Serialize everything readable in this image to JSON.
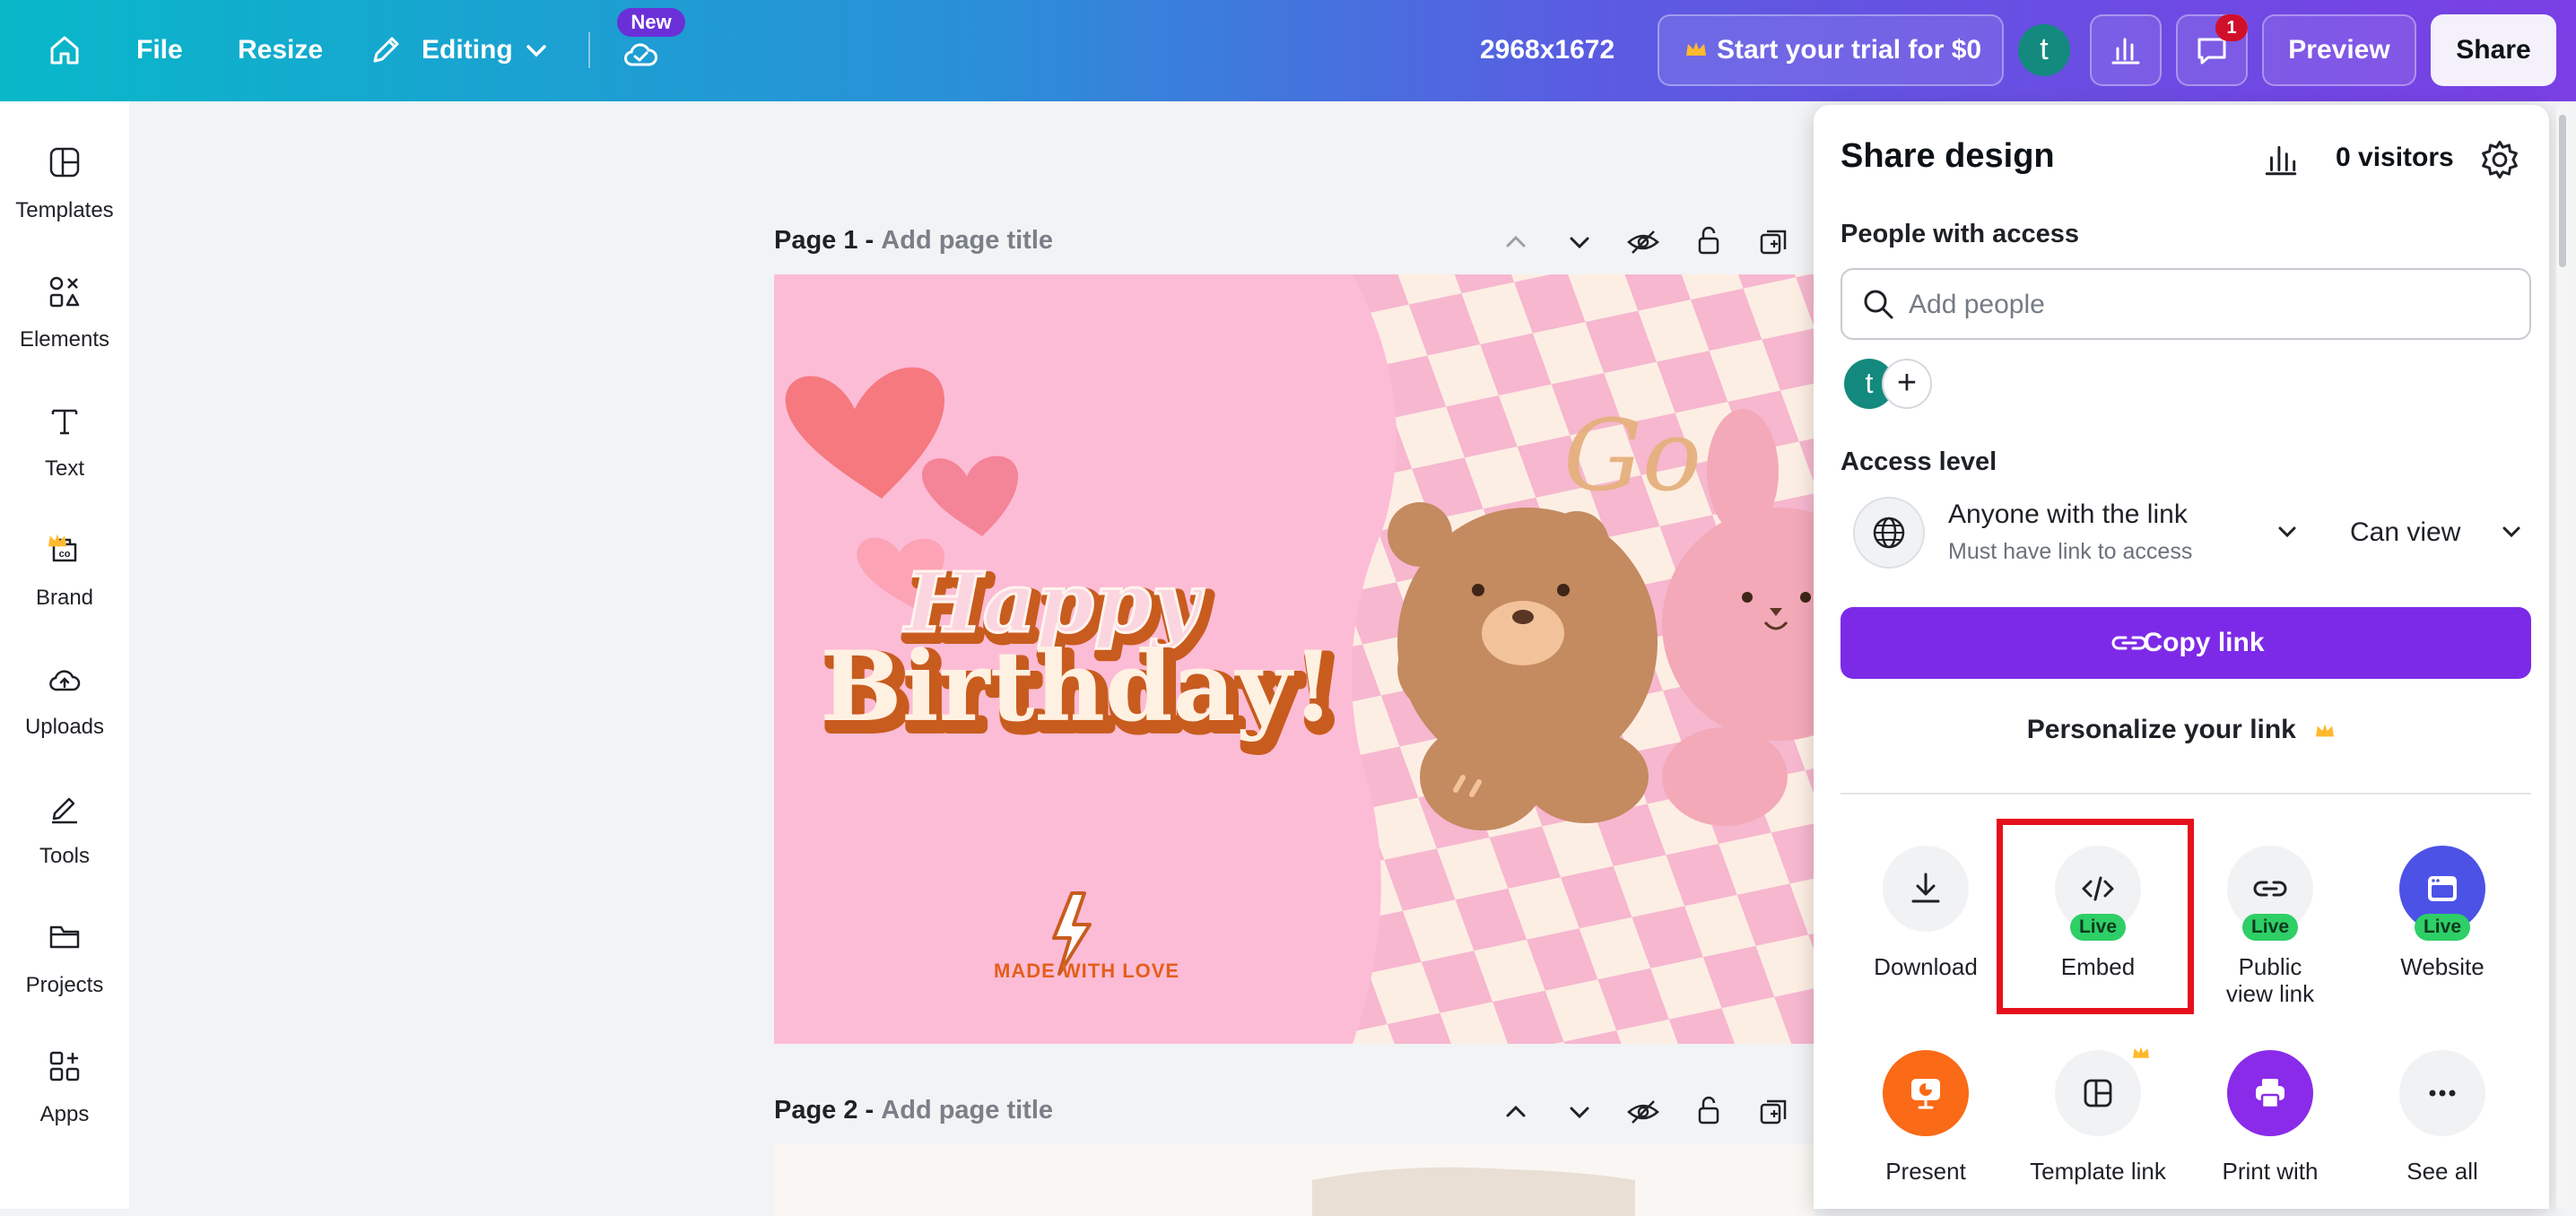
{
  "topbar": {
    "file_label": "File",
    "resize_label": "Resize",
    "editing_label": "Editing",
    "new_badge": "New",
    "dimensions": "2968x1672",
    "trial_label": "Start your trial for $0",
    "avatar_initial": "t",
    "notification_count": "1",
    "preview_label": "Preview",
    "share_label": "Share"
  },
  "sidebar": {
    "items": [
      {
        "label": "Templates",
        "icon": "templates-icon"
      },
      {
        "label": "Elements",
        "icon": "elements-icon"
      },
      {
        "label": "Text",
        "icon": "text-icon"
      },
      {
        "label": "Brand",
        "icon": "brand-icon"
      },
      {
        "label": "Uploads",
        "icon": "uploads-icon"
      },
      {
        "label": "Tools",
        "icon": "tools-icon"
      },
      {
        "label": "Projects",
        "icon": "projects-icon"
      },
      {
        "label": "Apps",
        "icon": "apps-icon"
      }
    ]
  },
  "canvas": {
    "page1": {
      "number": "Page 1 -",
      "placeholder": "Add page title"
    },
    "page2": {
      "number": "Page 2 -",
      "placeholder": "Add page title"
    },
    "design": {
      "happy": "Happy",
      "birthday": "Birthday!",
      "go_text": "Go~",
      "made_with_love": "MADE WITH LOVE"
    }
  },
  "share_panel": {
    "title": "Share design",
    "visitors": "0 visitors",
    "people_label": "People with access",
    "search_placeholder": "Add people",
    "avatar_initial": "t",
    "access_level_label": "Access level",
    "access_option": "Anyone with the link",
    "access_sub": "Must have link to access",
    "permission": "Can view",
    "copy_link_label": "Copy link",
    "personalize_label": "Personalize your link",
    "live_badge": "Live",
    "options_row1": [
      {
        "label": "Download",
        "live": false
      },
      {
        "label": "Embed",
        "live": true
      },
      {
        "label": "Public view link",
        "live": true
      },
      {
        "label": "Website",
        "live": true
      }
    ],
    "options_row2": [
      {
        "label": "Present"
      },
      {
        "label": "Template link"
      },
      {
        "label": "Print with"
      },
      {
        "label": "See all"
      }
    ]
  },
  "colors": {
    "accent_purple": "#7d2ae8",
    "live_green": "#2ecf66",
    "highlight_red": "#e5101c",
    "avatar_teal": "#138a7d",
    "design_pink": "#fdbcd6"
  }
}
